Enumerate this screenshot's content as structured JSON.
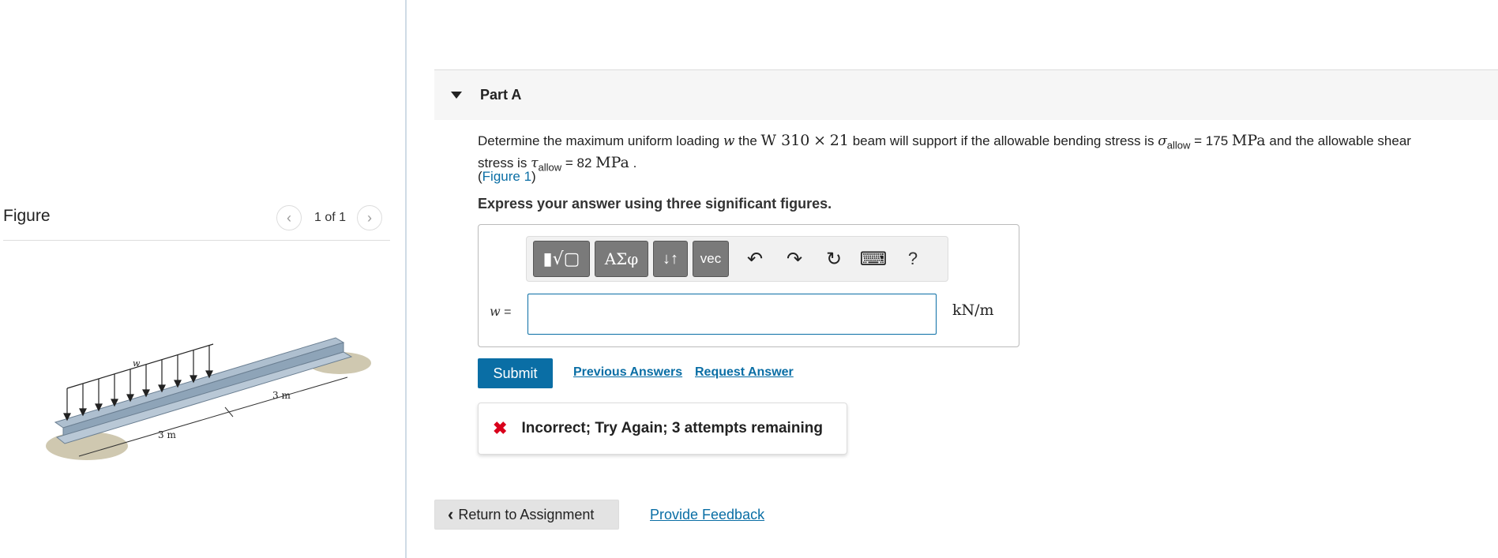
{
  "figure_pane": {
    "title": "Figure",
    "prev_icon": "chevron-left-icon",
    "next_icon": "chevron-right-icon",
    "counter": "1 of 1",
    "diagram_labels": {
      "load": "w",
      "span_left": "3 m",
      "span_right": "3 m"
    }
  },
  "part": {
    "title": "Part A",
    "caret_icon": "caret-down-icon"
  },
  "question": {
    "text_1": "Determine the maximum uniform loading",
    "var_w": "w",
    "text_2": "the",
    "beam": "W 310",
    "times": "×",
    "beam_num": "21",
    "text_3": "beam will support if the allowable bending stress is",
    "sigma": "σ",
    "sigma_sub": "allow",
    "text_4": "= 175",
    "mpa": "MPa",
    "text_5": "and the allowable shear",
    "text_6": "stress is",
    "tau": "τ",
    "tau_sub": "allow",
    "text_7": "= 82",
    "mpa2": "MPa",
    "period": ".",
    "figure_open": "(",
    "figure_link": "Figure 1",
    "figure_close": ")"
  },
  "instruction": "Express your answer using three significant figures.",
  "toolbar": {
    "btn_template": "▮√▢",
    "btn_greek": "ΑΣφ",
    "btn_arrows": "↓↑",
    "btn_vec": "vec",
    "undo_icon": "undo-icon",
    "redo_icon": "redo-icon",
    "reset_icon": "reset-icon",
    "keyboard_icon": "keyboard-icon",
    "help": "?"
  },
  "answer": {
    "label_var": "w",
    "label_eq": "=",
    "value": "",
    "unit": "kN/m"
  },
  "actions": {
    "submit": "Submit",
    "previous_answers": "Previous Answers",
    "request_answer": "Request Answer"
  },
  "feedback": {
    "icon": "x-icon",
    "message": "Incorrect; Try Again; 3 attempts remaining"
  },
  "footer": {
    "return": "Return to Assignment",
    "provide_feedback": "Provide Feedback"
  },
  "colors": {
    "accent": "#0a6ea5",
    "error": "#d9001b"
  }
}
